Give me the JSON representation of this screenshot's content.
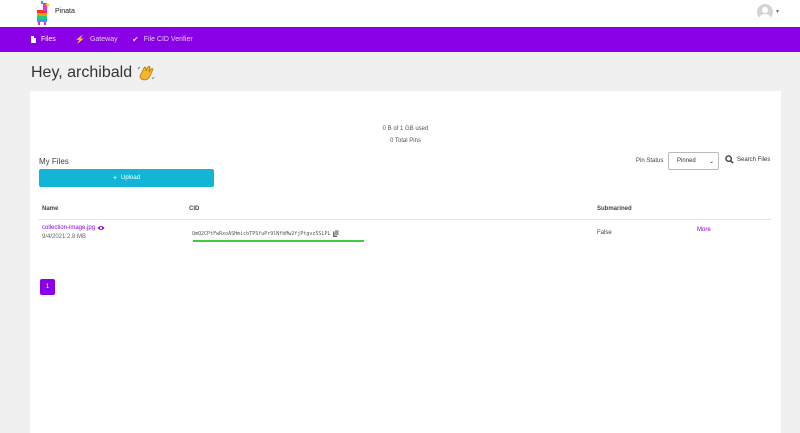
{
  "app": {
    "brand": "Pinata",
    "accent_color": "#8a00e6",
    "logo_icon": "pinata-logo-icon",
    "avatar_icon": "user-avatar-icon"
  },
  "nav": {
    "items": [
      {
        "label": "Files",
        "icon": "file-icon",
        "active": true
      },
      {
        "label": "Gateway",
        "icon": "bolt-icon",
        "active": false
      },
      {
        "label": "File CID Verifier",
        "icon": "double-check-icon",
        "active": false
      }
    ]
  },
  "greeting": {
    "text": "Hey, archibald",
    "icon": "waving-hand-icon"
  },
  "usage": {
    "storage": "0 B of 1 GB used",
    "pins": "0 Total Pins"
  },
  "files": {
    "title": "My Files",
    "upload_label": "Upload",
    "pin_status_label": "Pin Status",
    "pin_status_value": "Pinned",
    "search_label": "Search Files",
    "columns": {
      "name": "Name",
      "cid": "CID",
      "submarined": "Submarined"
    },
    "rows": [
      {
        "name": "collection-image.jpg",
        "meta": "9/4/2021 2.8 MB",
        "cid": "QmQ2CPtFwRxoASHmicbTPSfuPr9lNfbMw2fjPtgvz5SLPL",
        "submarined": "False",
        "action": "More"
      }
    ],
    "pagination": {
      "current": "1"
    }
  }
}
